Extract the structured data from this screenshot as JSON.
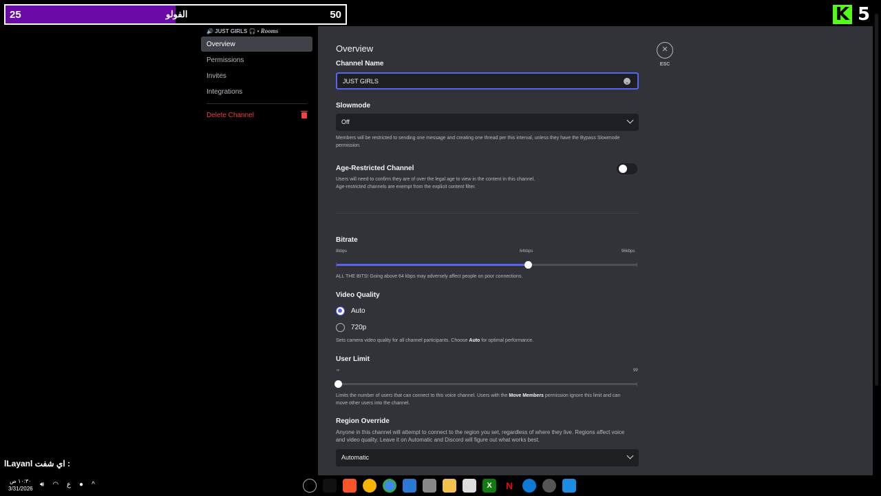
{
  "overlay": {
    "goal_left": "25",
    "goal_label": "الفولو",
    "goal_right": "50",
    "goal_progress": 0.5,
    "goal_color": "#6c0aa8",
    "brand_letter": "K",
    "brand_number": "5",
    "brand_color": "#53fc18",
    "chat_user": "lLayanl",
    "chat_message": "اي شفت :"
  },
  "sidebar": {
    "header_channel": "🔊 JUST GIRLS 🎧 •",
    "header_category": "Rooms",
    "items": [
      {
        "label": "Overview",
        "active": true
      },
      {
        "label": "Permissions",
        "active": false
      },
      {
        "label": "Invites",
        "active": false
      },
      {
        "label": "Integrations",
        "active": false
      }
    ],
    "delete_label": "Delete Channel"
  },
  "overview": {
    "title": "Overview",
    "channel_name_label": "Channel Name",
    "channel_name_value": "JUST GIRLS",
    "slowmode_label": "Slowmode",
    "slowmode_value": "Off",
    "slowmode_hint": "Members will be restricted to sending one message and creating one thread per this interval, unless they have the Bypass Slowmode permission.",
    "age_label": "Age-Restricted Channel",
    "age_hint_1": "Users will need to confirm they are of over the legal age to view in the content in this channel.",
    "age_hint_2": "Age-restricted channels are exempt from the explicit content filter.",
    "age_enabled": false,
    "bitrate_label": "Bitrate",
    "bitrate_min": "8kbps",
    "bitrate_mid": "64kbps",
    "bitrate_max": "96kbps",
    "bitrate_value_kbps": 64,
    "bitrate_hint": "ALL THE BITS! Going above 64 kbps may adversely affect people on poor connections.",
    "video_quality_label": "Video Quality",
    "video_options": [
      "Auto",
      "720p"
    ],
    "video_selected": "Auto",
    "video_hint_pre": "Sets camera video quality for all channel participants. Choose",
    "video_hint_bold": "Auto",
    "video_hint_post": "for optimal performance.",
    "user_limit_label": "User Limit",
    "user_limit_min": "∞",
    "user_limit_max": "99",
    "user_limit_value": 0,
    "user_limit_hint_pre": "Limits the number of users that can connect to this voice channel. Users with the",
    "user_limit_hint_bold": "Move Members",
    "user_limit_hint_post": "permission ignore this limit and can move other users into the channel.",
    "region_label": "Region Override",
    "region_hint": "Anyone in this channel will attempt to connect to the region you set, regardless of where they live. Regions affect voice and video quality. Leave it on Automatic and Discord will figure out what works best.",
    "region_value": "Automatic",
    "esc_label": "ESC",
    "accent_color": "#5865f2",
    "danger_color": "#f23f42"
  },
  "taskbar": {
    "time": "١٠:٣٠ ص",
    "date": "3/31/2026",
    "lang": "ع",
    "apps": [
      "copilot-icon",
      "brave-icon",
      "chrome-canary-icon",
      "chrome-icon",
      "photos-icon",
      "notepad-icon",
      "file-explorer-icon",
      "store-icon",
      "xbox-icon",
      "netflix-icon",
      "edge-icon",
      "settings-icon",
      "windows-icon"
    ]
  }
}
